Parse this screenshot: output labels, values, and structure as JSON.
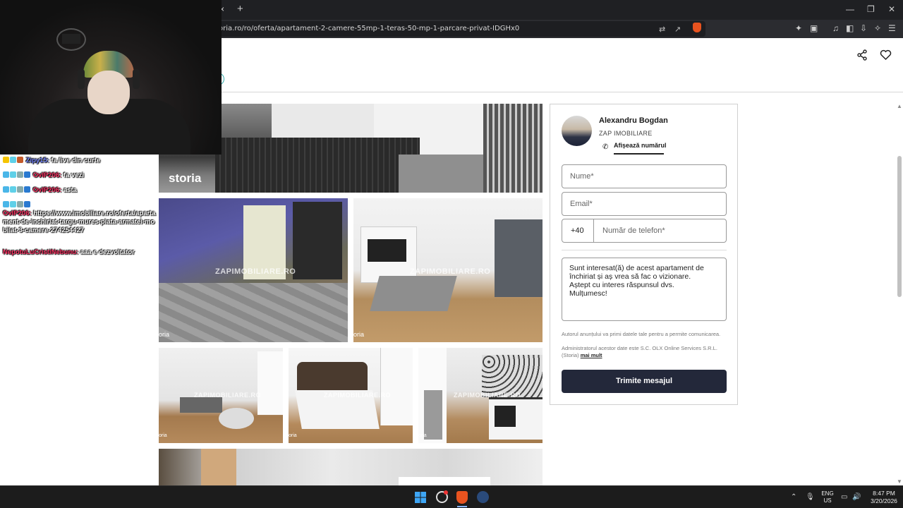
{
  "browser": {
    "tab_close": "×",
    "new_tab": "+",
    "url": "oria.ro/ro/oferta/apartament-2-camere-55mp-1-teras-50-mp-1-parcare-privat-IDGHx0",
    "window_controls": {
      "minimize": "—",
      "maximize": "❐",
      "close": "✕"
    }
  },
  "header": {
    "share_icon": "share-icon",
    "favorite_icon": "heart-icon"
  },
  "gallery": {
    "brand": "storia",
    "watermark": "ZAPIMOBILIARE.RO",
    "small_label": "oria"
  },
  "contact": {
    "agent_name": "Alexandru Bogdan",
    "agency": "ZAP IMOBILIARE",
    "show_phone": "Afișează numărul",
    "name_placeholder": "Nume*",
    "email_placeholder": "Email*",
    "phone_prefix": "+40",
    "phone_placeholder": "Număr de telefon*",
    "message": "Sunt interesat(ă) de acest apartament de închiriat și aș vrea să fac o vizionare.\nAștept cu interes răspunsul dvs.\nMulțumesc!",
    "notice1": "Autorul anunțului va primi datele tale pentru a permite comunicarea.",
    "notice2": "Administratorul acestor date este S.C. OLX Online Services S.R.L. (Storia)",
    "more_link": "mai mult",
    "send_label": "Trimite mesajul"
  },
  "chat": [
    {
      "user": "Zipy15:",
      "text": "fa live din curte"
    },
    {
      "user": "OvIP206:",
      "text": "fa vezi"
    },
    {
      "user": "OvIP206:",
      "text": "asta"
    },
    {
      "user": "OvIP206:",
      "text": "https://www.imobiliare.ro/oferta/apartament-de-inchiriat-targu-mures-piata-armatei-mobilat-3-camere-274254427"
    },
    {
      "user": "NepotuLuCristiNebunu:",
      "text": "aaa e dezvoltator"
    }
  ],
  "taskbar": {
    "lang_top": "ENG",
    "lang_bottom": "US",
    "time": "8:47 PM",
    "date": "3/20/2026"
  },
  "colors": {
    "send_button": "#23283a",
    "chat_user": "#ff3366",
    "brave": "#e8531f"
  }
}
